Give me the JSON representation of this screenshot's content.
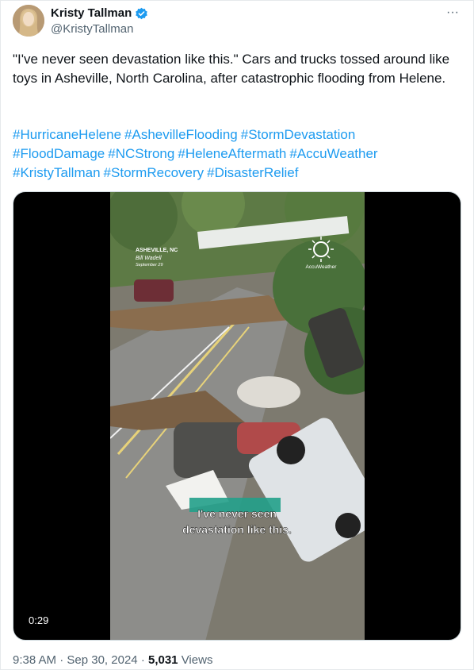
{
  "author": {
    "display_name": "Kristy Tallman",
    "handle": "@KristyTallman",
    "verified_icon": "verified-badge-icon"
  },
  "more_label": "···",
  "tweet": {
    "text": "\"I've never seen devastation like this.\" Cars and trucks tossed around like toys in Asheville, North Carolina, after catastrophic flooding from Helene.",
    "hashtags": [
      "#HurricaneHelene",
      "#AshevilleFlooding",
      "#StormDevastation",
      "#FloodDamage",
      "#NCStrong",
      "#HeleneAftermath",
      "#AccuWeather",
      "#KristyTallman",
      "#StormRecovery",
      "#DisasterRelief"
    ]
  },
  "video": {
    "location_label": "ASHEVILLE, NC",
    "credit_name": "Bill Wadell",
    "credit_date": "September 29",
    "brand": "AccuWeather",
    "caption_line1": "I've never seen",
    "caption_line2": "devastation like this.",
    "duration": "0:29"
  },
  "meta": {
    "time": "9:38 AM",
    "date": "Sep 30, 2024",
    "views_count": "5,031",
    "views_label": "Views"
  },
  "colors": {
    "link": "#1d9bf0",
    "muted": "#536471",
    "text": "#0f1419"
  }
}
